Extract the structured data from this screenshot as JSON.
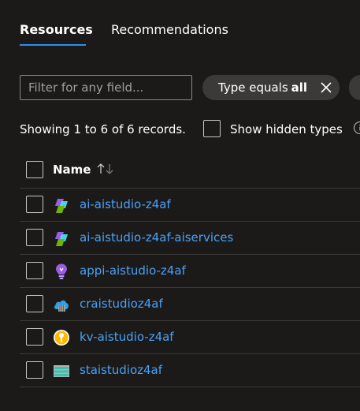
{
  "tabs": [
    {
      "label": "Resources",
      "active": true
    },
    {
      "label": "Recommendations",
      "active": false
    }
  ],
  "filter": {
    "placeholder": "Filter for any field...",
    "value": ""
  },
  "type_filter": {
    "label": "Type equals",
    "value": "all"
  },
  "records_text": "Showing 1 to 6 of 6 records.",
  "show_hidden_label": "Show hidden types",
  "table": {
    "header": {
      "name": "Name"
    },
    "rows": [
      {
        "name": "ai-aistudio-z4af",
        "icon": "ai-hub-icon"
      },
      {
        "name": "ai-aistudio-z4af-aiservices",
        "icon": "ai-services-icon"
      },
      {
        "name": "appi-aistudio-z4af",
        "icon": "app-insights-icon"
      },
      {
        "name": "craistudioz4af",
        "icon": "container-registry-icon"
      },
      {
        "name": "kv-aistudio-z4af",
        "icon": "key-vault-icon"
      },
      {
        "name": "staistudioz4af",
        "icon": "storage-account-icon"
      }
    ]
  },
  "colors": {
    "accent": "#2f8bf0",
    "link": "#4aa0f5",
    "background": "#1b1a19"
  }
}
